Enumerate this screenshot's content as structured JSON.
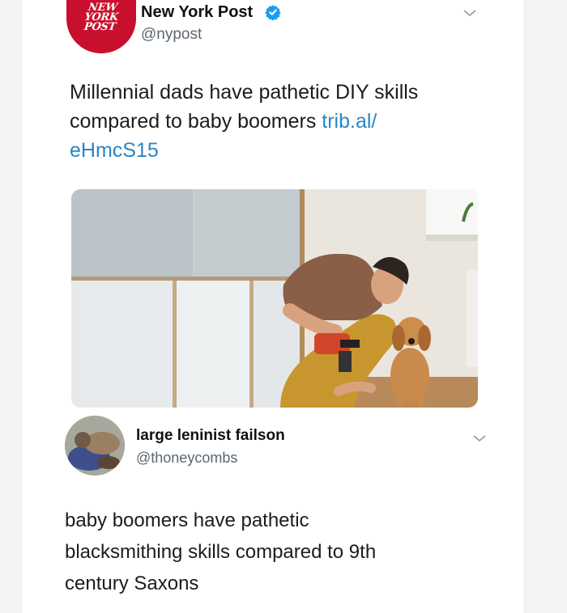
{
  "tweet1": {
    "logo_lines": [
      "NEW",
      "YORK",
      "POST"
    ],
    "display_name": "New York Post",
    "handle": "@nypost",
    "text_line1": "Millennial dads have pathetic DIY skills",
    "text_line2_prefix": "compared to baby boomers ",
    "link_part1": "trib.al/",
    "link_part2": "eHmcS15"
  },
  "tweet2": {
    "display_name": "large leninist failson",
    "handle": "@thoneycombs",
    "text_line1": "baby boomers have pathetic",
    "text_line2": "blacksmithing skills compared to 9th",
    "text_line3": "century Saxons"
  },
  "colors": {
    "nyp_red": "#c8102e",
    "verified_blue": "#1d9bf0",
    "link_blue": "#2a86c6",
    "handle_gray": "#5b6670"
  }
}
